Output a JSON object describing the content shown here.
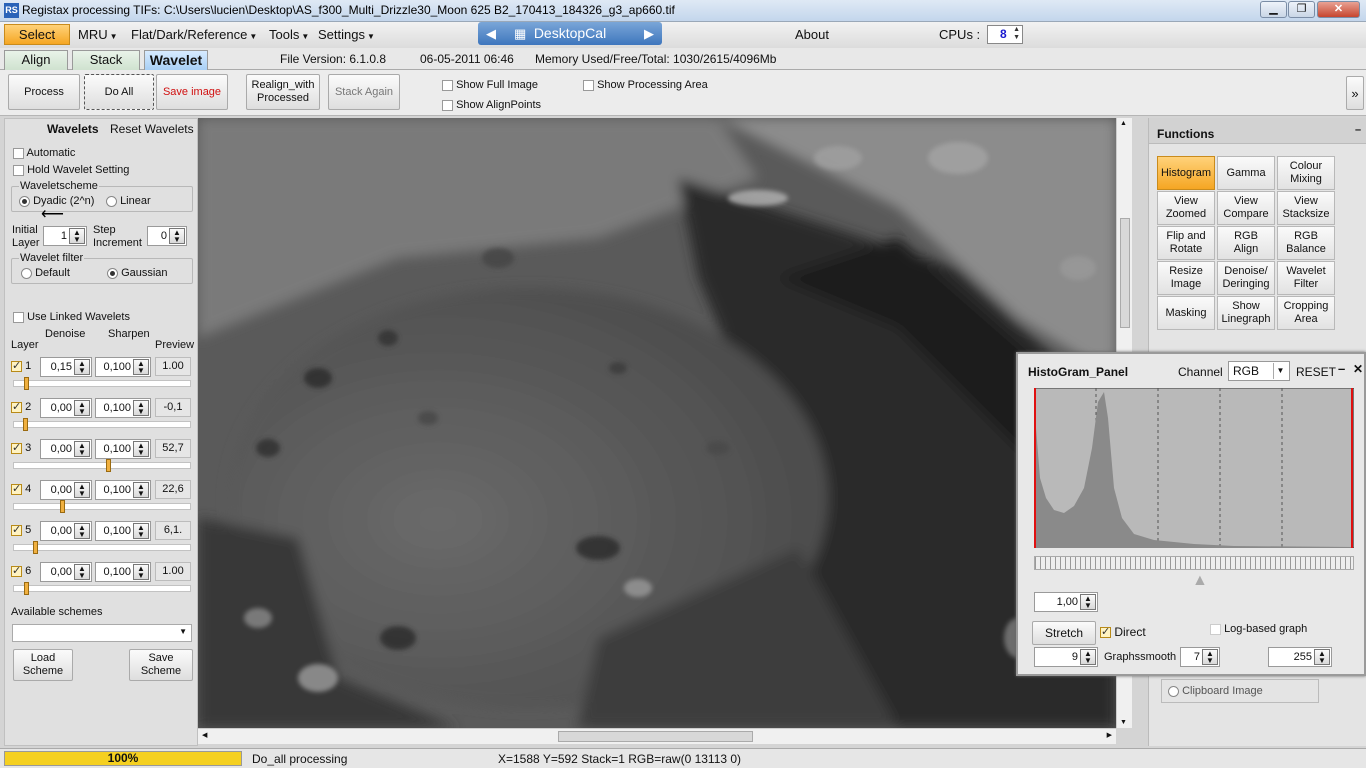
{
  "window": {
    "title": "Registax processing TIFs: C:\\Users\\lucien\\Desktop\\AS_f300_Multi_Drizzle30_Moon 625 B2_170413_184326_g3_ap660.tif",
    "app_icon": "RS",
    "controls": {
      "minimize": "▁",
      "maximize": "❐",
      "close": "✕"
    }
  },
  "menu": {
    "select": "Select",
    "items": [
      "MRU",
      "Flat/Dark/Reference",
      "Tools",
      "Settings"
    ],
    "overlay": "DesktopCal",
    "about": "About",
    "cpus_label": "CPUs :",
    "cpus_value": "8"
  },
  "tabs": {
    "align": "Align",
    "stack": "Stack",
    "wavelet": "Wavelet"
  },
  "info": {
    "file_version": "File Version: 6.1.0.8",
    "date": "06-05-2011 06:46",
    "memory": "Memory Used/Free/Total: 1030/2615/4096Mb"
  },
  "toolbar": {
    "process": "Process",
    "do_all": "Do All",
    "save_image": "Save image",
    "realign_1": "Realign_with",
    "realign_2": "Processed",
    "stack_again": "Stack Again",
    "show_full_image": "Show Full Image",
    "show_alignpoints": "Show AlignPoints",
    "show_processing_area": "Show Processing Area",
    "collapse": "»"
  },
  "wavelets": {
    "title": "Wavelets",
    "reset": "Reset Wavelets",
    "automatic": "Automatic",
    "hold": "Hold Wavelet Setting",
    "scheme_title": "Waveletscheme",
    "dyadic": "Dyadic (2^n)",
    "linear": "Linear",
    "initial_1": "Initial",
    "initial_2": "Layer",
    "initial_value": "1",
    "step_1": "Step",
    "step_2": "Increment",
    "step_value": "0",
    "filter_title": "Wavelet filter",
    "default": "Default",
    "gaussian": "Gaussian",
    "use_linked": "Use Linked Wavelets",
    "col_denoise": "Denoise",
    "col_sharpen": "Sharpen",
    "col_layer": "Layer",
    "col_preview": "Preview",
    "layers": [
      {
        "num": "1",
        "denoise": "0,15",
        "sharpen": "0,100",
        "preview": "1.00",
        "level": 0.06
      },
      {
        "num": "2",
        "denoise": "0,00",
        "sharpen": "0,100",
        "preview": "-0,1",
        "level": 0.05
      },
      {
        "num": "3",
        "denoise": "0,00",
        "sharpen": "0,100",
        "preview": "52,7",
        "level": 0.54
      },
      {
        "num": "4",
        "denoise": "0,00",
        "sharpen": "0,100",
        "preview": "22,6",
        "level": 0.27
      },
      {
        "num": "5",
        "denoise": "0,00",
        "sharpen": "0,100",
        "preview": "6,1.",
        "level": 0.11
      },
      {
        "num": "6",
        "denoise": "0,00",
        "sharpen": "0,100",
        "preview": "1.00",
        "level": 0.06
      }
    ],
    "available": "Available schemes",
    "load_1": "Load",
    "load_2": "Scheme",
    "save_1": "Save",
    "save_2": "Scheme"
  },
  "functions": {
    "title": "Functions",
    "buttons": [
      [
        "Histogram",
        ""
      ],
      [
        "Gamma",
        ""
      ],
      [
        "Colour",
        "Mixing"
      ],
      [
        "View",
        "Zoomed"
      ],
      [
        "View",
        "Compare"
      ],
      [
        "View",
        "Stacksize"
      ],
      [
        "Flip and",
        "Rotate"
      ],
      [
        "RGB",
        "Align"
      ],
      [
        "RGB",
        "Balance"
      ],
      [
        "Resize",
        "Image"
      ],
      [
        "Denoise/",
        "Deringing"
      ],
      [
        "Wavelet",
        "Filter"
      ],
      [
        "Masking",
        ""
      ],
      [
        "Show",
        "Linegraph"
      ],
      [
        "Cropping",
        "Area"
      ]
    ],
    "clipboard": "Clipboard Image"
  },
  "histogram": {
    "title": "HistoGram_Panel",
    "channel_label": "Channel",
    "channel_value": "RGB",
    "reset": "RESET",
    "gamma_value": "1,00",
    "stretch": "Stretch",
    "direct": "Direct",
    "log_based": "Log-based graph",
    "left_value": "9",
    "graphssmooth": "Graphssmooth",
    "smooth_value": "7",
    "right_value": "255"
  },
  "status": {
    "progress": "100%",
    "progress_fraction": 1.0,
    "task": "Do_all processing",
    "coords": "X=1588 Y=592 Stack=1 RGB=raw(0 13113 0)"
  }
}
